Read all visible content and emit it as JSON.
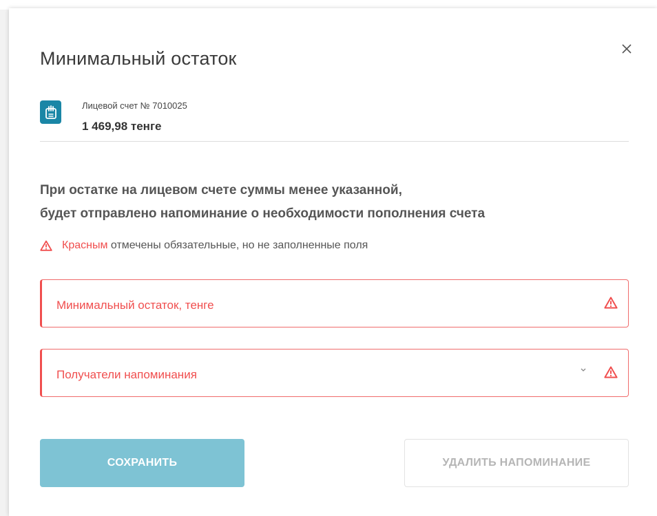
{
  "modal": {
    "title": "Минимальный остаток",
    "close_label": "×"
  },
  "account": {
    "label": "Лицевой счет № 7010025",
    "amount": "1 469,98 тенге",
    "icon": "document-hand-icon"
  },
  "description": {
    "line1": "При остатке на лицевом счете суммы менее указанной,",
    "line2": "будет отправлено напоминание о необходимости пополнения счета"
  },
  "notice": {
    "highlight": "Красным",
    "text": " отмечены обязательные, но не заполненные поля"
  },
  "fields": {
    "min_balance": {
      "placeholder": "Минимальный остаток, тенге"
    },
    "recipients": {
      "placeholder": "Получатели напоминания"
    }
  },
  "buttons": {
    "save": "СОХРАНИТЬ",
    "delete": "УДАЛИТЬ НАПОМИНАНИЕ"
  },
  "colors": {
    "accent": "#1a86a6",
    "error": "#f04e4e",
    "save_button": "#7ec3d4",
    "disabled_text": "#b5b5b5"
  }
}
